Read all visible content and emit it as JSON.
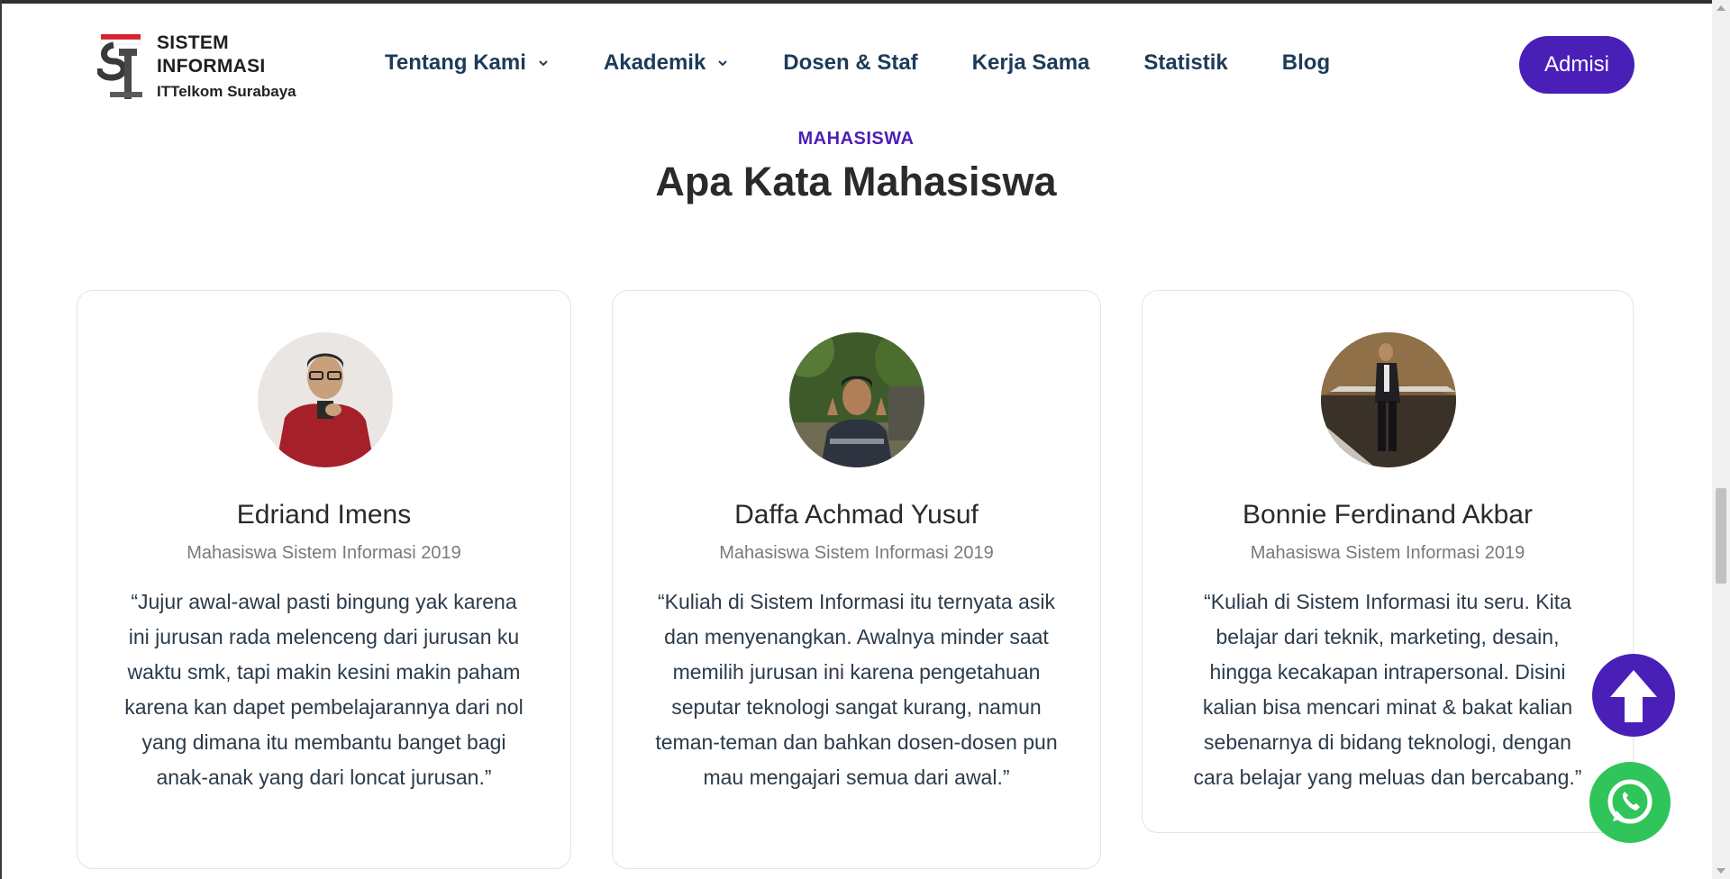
{
  "header": {
    "logo": {
      "line1": "SISTEM",
      "line2": "INFORMASI",
      "line3": "ITTelkom Surabaya"
    },
    "nav": [
      {
        "label": "Tentang Kami",
        "has_dropdown": true
      },
      {
        "label": "Akademik",
        "has_dropdown": true
      },
      {
        "label": "Dosen & Staf",
        "has_dropdown": false
      },
      {
        "label": "Kerja Sama",
        "has_dropdown": false
      },
      {
        "label": "Statistik",
        "has_dropdown": false
      },
      {
        "label": "Blog",
        "has_dropdown": false
      }
    ],
    "cta_label": "Admisi"
  },
  "section": {
    "eyebrow": "MAHASISWA",
    "title": "Apa Kata Mahasiswa"
  },
  "testimonials": [
    {
      "name": "Edriand Imens",
      "role": "Mahasiswa Sistem Informasi 2019",
      "quote": "“Jujur awal-awal pasti bingung yak karena ini jurusan rada melenceng dari jurusan ku waktu smk, tapi makin kesini makin paham karena kan dapet pembelajarannya dari nol yang dimana itu membantu banget bagi anak-anak yang dari loncat jurusan.”"
    },
    {
      "name": "Daffa Achmad Yusuf",
      "role": "Mahasiswa Sistem Informasi 2019",
      "quote": "“Kuliah di Sistem Informasi itu ternyata asik dan menyenangkan. Awalnya minder saat memilih jurusan ini karena pengetahuan seputar teknologi sangat kurang, namun teman-teman dan bahkan dosen-dosen pun mau mengajari semua dari awal.”"
    },
    {
      "name": "Bonnie Ferdinand Akbar",
      "role": "Mahasiswa Sistem Informasi 2019",
      "quote": "“Kuliah di Sistem Informasi itu seru. Kita belajar dari teknik, marketing, desain, hingga kecakapan intrapersonal. Disini kalian bisa mencari minat & bakat kalian sebenarnya di bidang teknologi, dengan cara belajar yang meluas dan bercabang.”"
    }
  ],
  "floating": {
    "scroll_top_icon": "arrow-up-icon",
    "whatsapp_icon": "whatsapp-icon"
  },
  "colors": {
    "accent": "#4a1fb8",
    "nav_text": "#1d3b58",
    "whatsapp": "#2fc55a"
  }
}
